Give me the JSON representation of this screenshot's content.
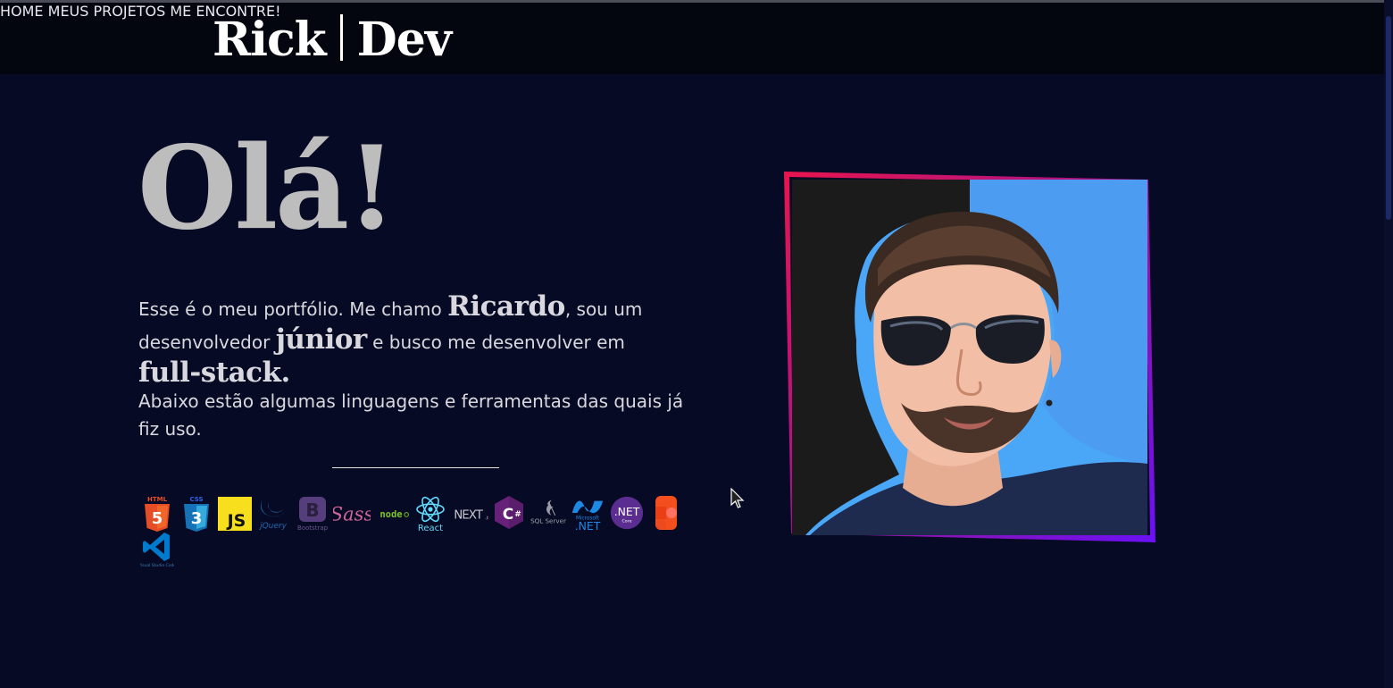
{
  "header": {
    "brand_left": "Rick",
    "brand_right": "Dev",
    "nav": [
      "HOME",
      "MEUS PROJETOS",
      "ME ENCONTRE!"
    ]
  },
  "hero": {
    "greeting": "Olá!",
    "intro_part1": "Esse é o meu portfólio. Me chamo ",
    "name": "Ricardo",
    "intro_part2": ", sou um desenvolvedor ",
    "level": "júnior",
    "intro_part3": " e busco me desenvolver em ",
    "area": "full-stack.",
    "tools_text": "Abaixo estão algumas linguagens e ferramentas das quais já fiz uso."
  },
  "tech_icons": [
    {
      "name": "html5-icon",
      "label": "HTML"
    },
    {
      "name": "css3-icon",
      "label": "CSS"
    },
    {
      "name": "javascript-icon",
      "label": "JS"
    },
    {
      "name": "jquery-icon",
      "label": "jQuery"
    },
    {
      "name": "bootstrap-icon",
      "label": "Bootstrap"
    },
    {
      "name": "sass-icon",
      "label": "Sass"
    },
    {
      "name": "nodejs-icon",
      "label": "node"
    },
    {
      "name": "react-icon",
      "label": "React"
    },
    {
      "name": "nextjs-icon",
      "label": "NEXT"
    },
    {
      "name": "csharp-icon",
      "label": "C#"
    },
    {
      "name": "sql-server-icon",
      "label": "SQL Server"
    },
    {
      "name": "dotnet-icon",
      "label": ".NET"
    },
    {
      "name": "dotnet-core-icon",
      "label": ".NET"
    },
    {
      "name": "figma-icon",
      "label": ""
    },
    {
      "name": "vscode-icon",
      "label": "Visual Studio Code"
    }
  ],
  "colors": {
    "background": "#070a24",
    "navbar": "#03050f",
    "frame_gradient_start": "#e8154e",
    "frame_gradient_end": "#6a11f5",
    "photo_bg": "#4c9cf2"
  }
}
